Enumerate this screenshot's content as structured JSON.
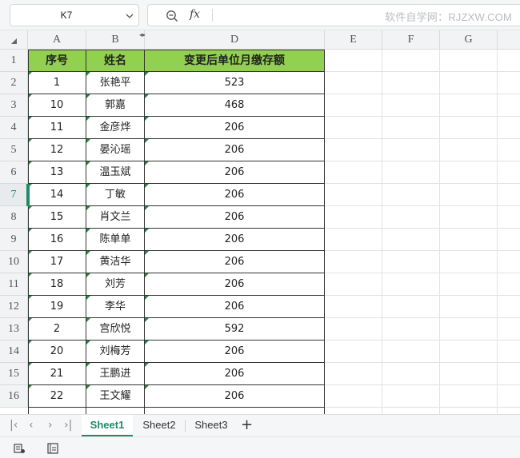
{
  "formula_bar": {
    "name_box": "K7",
    "fx_label": "fx",
    "watermark": "软件自学网：RJZXW.COM"
  },
  "columns": [
    "A",
    "B",
    "D",
    "E",
    "F",
    "G"
  ],
  "rows": [
    "1",
    "2",
    "3",
    "4",
    "5",
    "6",
    "7",
    "8",
    "9",
    "10",
    "11",
    "12",
    "13",
    "14",
    "15",
    "16"
  ],
  "active_row": "7",
  "table": {
    "headers": [
      "序号",
      "姓名",
      "变更后单位月缴存额"
    ],
    "rows": [
      [
        "1",
        "张艳平",
        "523"
      ],
      [
        "10",
        "郭嘉",
        "468"
      ],
      [
        "11",
        "金彦烨",
        "206"
      ],
      [
        "12",
        "晏沁瑶",
        "206"
      ],
      [
        "13",
        "温玉斌",
        "206"
      ],
      [
        "14",
        "丁敏",
        "206"
      ],
      [
        "15",
        "肖文兰",
        "206"
      ],
      [
        "16",
        "陈单单",
        "206"
      ],
      [
        "17",
        "黄洁华",
        "206"
      ],
      [
        "18",
        "刘芳",
        "206"
      ],
      [
        "19",
        "李华",
        "206"
      ],
      [
        "2",
        "宫欣悦",
        "592"
      ],
      [
        "20",
        "刘梅芳",
        "206"
      ],
      [
        "21",
        "王鹏进",
        "206"
      ],
      [
        "22",
        "王文耀",
        "206"
      ]
    ]
  },
  "sheets": {
    "tabs": [
      "Sheet1",
      "Sheet2",
      "Sheet3"
    ],
    "active": "Sheet1",
    "add_label": "+"
  },
  "nav_icons": [
    "first-sheet-icon",
    "prev-sheet-icon",
    "next-sheet-icon",
    "last-sheet-icon"
  ],
  "colors": {
    "header_fill": "#92d050",
    "accent": "#1f8a64"
  }
}
